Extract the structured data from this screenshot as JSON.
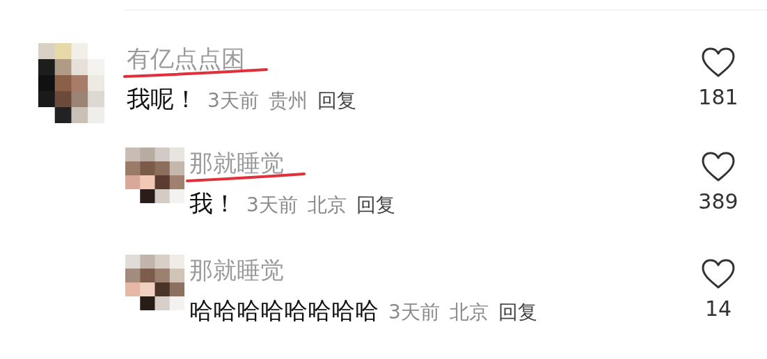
{
  "comments": [
    {
      "name": "有亿点点困",
      "underlined": true,
      "text": "我呢！",
      "time": "3天前",
      "location": "贵州",
      "reply": "回复",
      "likes": "181",
      "children": [
        {
          "name": "那就睡觉",
          "underlined": true,
          "text": "我！",
          "time": "3天前",
          "location": "北京",
          "reply": "回复",
          "likes": "389"
        },
        {
          "name": "那就睡觉",
          "underlined": false,
          "text": "哈哈哈哈哈哈哈哈",
          "time": "3天前",
          "location": "北京",
          "reply": "回复",
          "likes": "14"
        }
      ]
    }
  ]
}
